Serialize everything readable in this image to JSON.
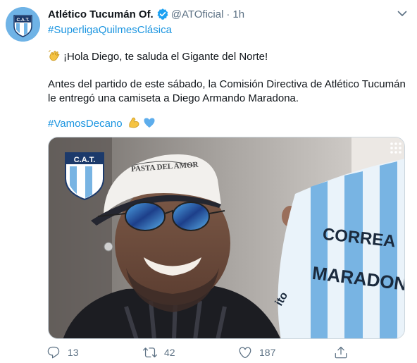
{
  "tweet": {
    "author_name": "Atlético Tucumán Of.",
    "handle": "@ATOficial",
    "separator": "·",
    "time": "1h",
    "hashtag_top": "#SuperligaQuilmesClásica",
    "greeting": "¡Hola Diego, te saluda el Gigante del Norte!",
    "body_line1": "Antes del partido de este sábado, la Comisión Directiva de Atlético Tucumán",
    "body_line2": "le entregó una camiseta a Diego Armando Maradona.",
    "hashtag_bottom": "#VamosDecano",
    "avatar_text": "C.A.T.",
    "media": {
      "crest_text": "C.A.T.",
      "cap_text": "PASTA DEL AMOR",
      "shirt_text_1": "CORREA",
      "shirt_text_2": "MARADONA",
      "shirt_brand": "ito"
    },
    "stats": {
      "replies": "13",
      "retweets": "42",
      "likes": "187"
    }
  },
  "colors": {
    "link": "#1b95e0",
    "muted": "#5b7083",
    "club_sky_blue": "#6fb3e6",
    "verified": "#1da1f2"
  },
  "icons": [
    "verified-icon",
    "chevron-down-icon",
    "waving-hand-icon",
    "flexed-biceps-icon",
    "blue-heart-icon",
    "reply-icon",
    "retweet-icon",
    "like-icon",
    "share-icon"
  ]
}
